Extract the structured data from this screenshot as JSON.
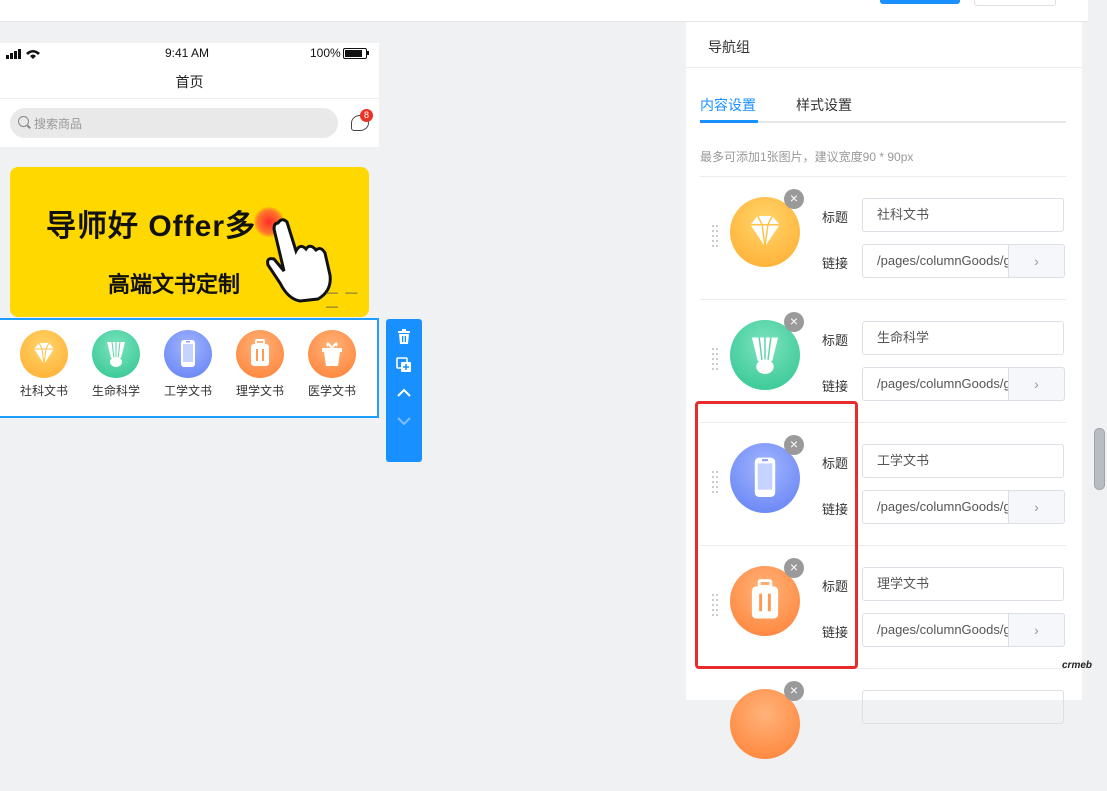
{
  "phone": {
    "time": "9:41 AM",
    "battery": "100%",
    "page_title": "首页",
    "search_placeholder": "搜索商品",
    "message_badge": "8",
    "banner": {
      "headline": "导师好 Offer多",
      "subline": "高端文书定制"
    },
    "nav_items": [
      {
        "label": "社科文书",
        "icon": "diamond-icon",
        "color": "#ffb83a"
      },
      {
        "label": "生命科学",
        "icon": "shuttlecock-icon",
        "color": "#3ccf9e"
      },
      {
        "label": "工学文书",
        "icon": "phone-icon",
        "color": "#6c8bf6"
      },
      {
        "label": "理学文书",
        "icon": "luggage-icon",
        "color": "#ff8a3d"
      },
      {
        "label": "医学文书",
        "icon": "gift-icon",
        "color": "#ff8a3d"
      }
    ]
  },
  "panel": {
    "title": "导航组",
    "tabs": [
      "内容设置",
      "样式设置"
    ],
    "active_tab": "内容设置",
    "hint": "最多可添加1张图片，建议宽度90 * 90px",
    "title_label": "标题",
    "link_label": "链接",
    "items": [
      {
        "title": "社科文书",
        "link": "/pages/columnGoods/goods_list/index",
        "icon": "diamond-icon",
        "color": "#ffb83a"
      },
      {
        "title": "生命科学",
        "link": "/pages/columnGoods/goods_list/index",
        "icon": "shuttlecock-icon",
        "color": "#3ccf9e"
      },
      {
        "title": "工学文书",
        "link": "/pages/columnGoods/goods_list/index",
        "icon": "phone-icon",
        "color": "#6c8bf6"
      },
      {
        "title": "理学文书",
        "link": "/pages/columnGoods/goods_list/index",
        "icon": "luggage-icon",
        "color": "#ff8a3d"
      }
    ]
  },
  "corner_logo": "crmeb"
}
